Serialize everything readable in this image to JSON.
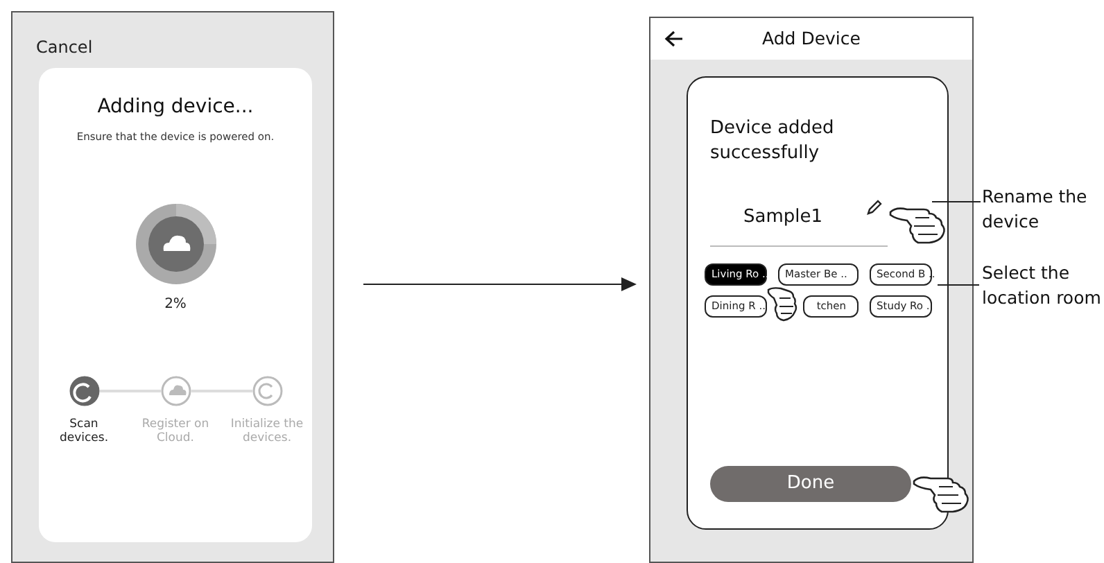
{
  "adding_screen": {
    "cancel": "Cancel",
    "title": "Adding device...",
    "subtitle": "Ensure that the device is powered on.",
    "progress": "2%",
    "steps": [
      {
        "label": "Scan devices.",
        "active": true,
        "kind": "scan"
      },
      {
        "label": "Register on Cloud.",
        "active": false,
        "kind": "cloud"
      },
      {
        "label": "Initialize the devices.",
        "active": false,
        "kind": "init"
      }
    ]
  },
  "add_device_screen": {
    "title": "Add Device",
    "heading": "Device added successfully",
    "device_name": "Sample1",
    "rooms": [
      {
        "label": "Living Ro ..",
        "selected": true
      },
      {
        "label": "Master Be ..",
        "selected": false
      },
      {
        "label": "Second B ..",
        "selected": false
      },
      {
        "label": "Dining R ..",
        "selected": false
      },
      {
        "label": "tchen",
        "selected": false
      },
      {
        "label": "Study Ro ..",
        "selected": false
      }
    ],
    "done_button": "Done"
  },
  "annotations": [
    {
      "text": "Rename the device"
    },
    {
      "text": "Select the location room"
    }
  ]
}
